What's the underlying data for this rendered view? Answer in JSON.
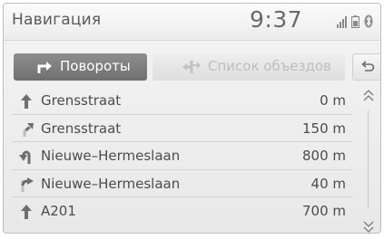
{
  "header": {
    "title": "Навигация",
    "clock": "9:37",
    "status_icons": [
      "signal-bars-icon",
      "battery-icon",
      "bluetooth-icon"
    ]
  },
  "tabs": [
    {
      "label": "Повороты",
      "icon": "turn-list-icon",
      "active": true
    },
    {
      "label": "Список объездов",
      "icon": "detour-icon",
      "active": false
    }
  ],
  "back_button": {
    "icon": "back-arrow-icon"
  },
  "turns": [
    {
      "icon": "straight-arrow-icon",
      "street": "Grensstraat",
      "distance": "0 m"
    },
    {
      "icon": "slight-right-arrow-icon",
      "street": "Grensstraat",
      "distance": "150 m"
    },
    {
      "icon": "sharp-left-arrow-icon",
      "street": "Nieuwe–Hermeslaan",
      "distance": "800 m"
    },
    {
      "icon": "keep-right-arrow-icon",
      "street": "Nieuwe–Hermeslaan",
      "distance": "40 m"
    },
    {
      "icon": "straight-arrow-icon",
      "street": "A201",
      "distance": "700 m"
    }
  ],
  "scroll": {
    "up_icon": "scroll-up-icon",
    "down_icon": "scroll-down-icon"
  },
  "colors": {
    "active_tab": "#7a7a7a",
    "inactive_text": "#bdbdbd",
    "text": "#4c4c4c",
    "background": "#f0f0f0"
  }
}
